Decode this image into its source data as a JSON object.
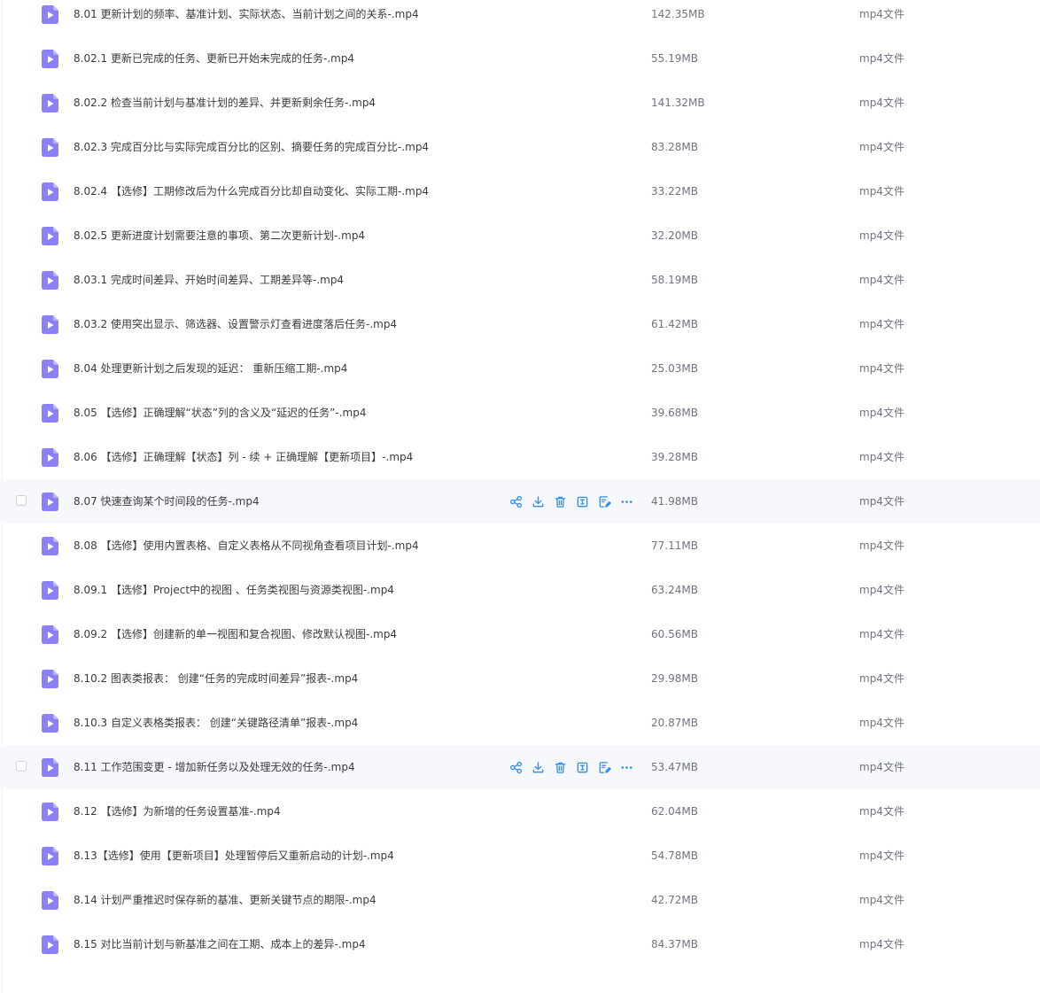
{
  "colors": {
    "icon_fill": "#8b80f7",
    "action_icon": "#2f8cf5",
    "hover_row_bg": "#f6f8fb"
  },
  "icons": {
    "file": "video-file-icon",
    "actions": [
      "share-icon",
      "download-icon",
      "delete-icon",
      "rename-icon",
      "edit-icon",
      "more-icon"
    ]
  },
  "files": [
    {
      "name": "8.01 更新计划的频率、基准计划、实际状态、当前计划之间的关系-.mp4",
      "size": "142.35MB",
      "type": "mp4文件"
    },
    {
      "name": "8.02.1 更新已完成的任务、更新已开始未完成的任务-.mp4",
      "size": "55.19MB",
      "type": "mp4文件"
    },
    {
      "name": "8.02.2 检查当前计划与基准计划的差异、并更新剩余任务-.mp4",
      "size": "141.32MB",
      "type": "mp4文件"
    },
    {
      "name": "8.02.3 完成百分比与实际完成百分比的区别、摘要任务的完成百分比-.mp4",
      "size": "83.28MB",
      "type": "mp4文件"
    },
    {
      "name": "8.02.4 【选修】工期修改后为什么完成百分比却自动变化、实际工期-.mp4",
      "size": "33.22MB",
      "type": "mp4文件"
    },
    {
      "name": "8.02.5 更新进度计划需要注意的事项、第二次更新计划-.mp4",
      "size": "32.20MB",
      "type": "mp4文件"
    },
    {
      "name": "8.03.1 完成时间差异、开始时间差异、工期差异等-.mp4",
      "size": "58.19MB",
      "type": "mp4文件"
    },
    {
      "name": "8.03.2 使用突出显示、筛选器、设置警示灯查看进度落后任务-.mp4",
      "size": "61.42MB",
      "type": "mp4文件"
    },
    {
      "name": "8.04 处理更新计划之后发现的延迟： 重新压缩工期-.mp4",
      "size": "25.03MB",
      "type": "mp4文件"
    },
    {
      "name": "8.05 【选修】正确理解“状态”列的含义及“延迟的任务”-.mp4",
      "size": "39.68MB",
      "type": "mp4文件"
    },
    {
      "name": "8.06 【选修】正确理解【状态】列 - 续 + 正确理解【更新项目】-.mp4",
      "size": "39.28MB",
      "type": "mp4文件"
    },
    {
      "name": "8.07 快速查询某个时间段的任务-.mp4",
      "size": "41.98MB",
      "type": "mp4文件",
      "hover": true
    },
    {
      "name": "8.08 【选修】使用内置表格、自定义表格从不同视角查看项目计划-.mp4",
      "size": "77.11MB",
      "type": "mp4文件"
    },
    {
      "name": "8.09.1 【选修】Project中的视图 、任务类视图与资源类视图-.mp4",
      "size": "63.24MB",
      "type": "mp4文件"
    },
    {
      "name": "8.09.2 【选修】创建新的单一视图和复合视图、修改默认视图-.mp4",
      "size": "60.56MB",
      "type": "mp4文件"
    },
    {
      "name": "8.10.2 图表类报表： 创建“任务的完成时间差异”报表-.mp4",
      "size": "29.98MB",
      "type": "mp4文件"
    },
    {
      "name": "8.10.3 自定义表格类报表： 创建“关键路径清单”报表-.mp4",
      "size": "20.87MB",
      "type": "mp4文件"
    },
    {
      "name": "8.11 工作范围变更 - 增加新任务以及处理无效的任务-.mp4",
      "size": "53.47MB",
      "type": "mp4文件",
      "hover": true
    },
    {
      "name": "8.12 【选修】为新增的任务设置基准-.mp4",
      "size": "62.04MB",
      "type": "mp4文件"
    },
    {
      "name": "8.13【选修】使用【更新项目】处理暂停后又重新启动的计划-.mp4",
      "size": "54.78MB",
      "type": "mp4文件"
    },
    {
      "name": "8.14 计划严重推迟时保存新的基准、更新关键节点的期限-.mp4",
      "size": "42.72MB",
      "type": "mp4文件"
    },
    {
      "name": "8.15 对比当前计划与新基准之间在工期、成本上的差异-.mp4",
      "size": "84.37MB",
      "type": "mp4文件"
    }
  ]
}
